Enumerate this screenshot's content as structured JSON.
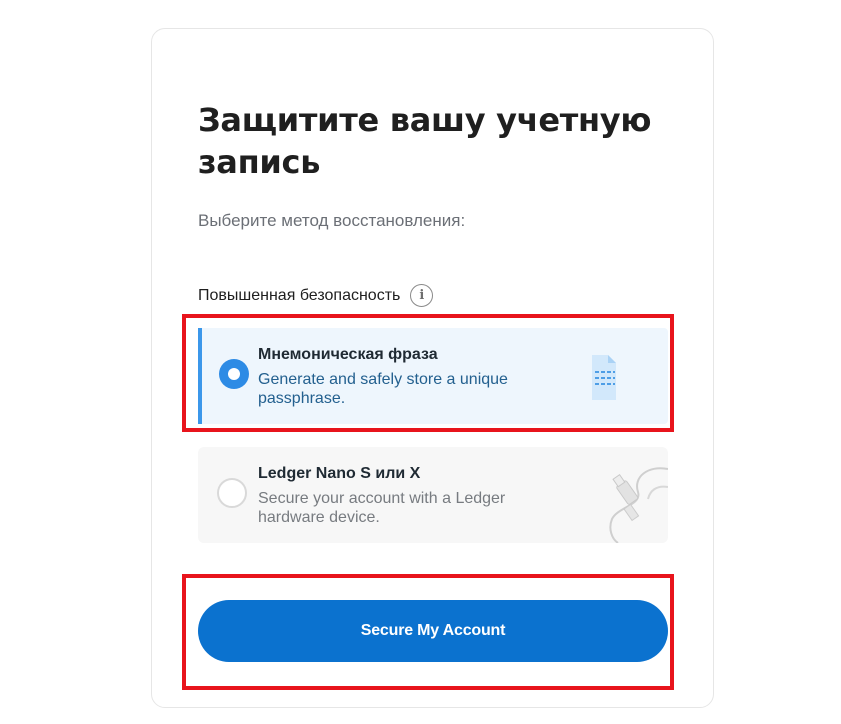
{
  "page": {
    "title": "Защитите вашу учетную запись",
    "subtitle": "Выберите метод восстановления:"
  },
  "section": {
    "label": "Повышенная безопасность",
    "info_icon": "info-icon"
  },
  "options": [
    {
      "title": "Мнемоническая фраза",
      "description": "Generate and safely store a unique passphrase.",
      "selected": true,
      "icon": "document-icon"
    },
    {
      "title": "Ledger Nano S или X",
      "description": "Secure your account with a Ledger hardware device.",
      "selected": false,
      "icon": "usb-device-icon"
    }
  ],
  "cta": {
    "label": "Secure My Account"
  },
  "colors": {
    "accent": "#0b72cf",
    "selected_bg": "#eef6fd",
    "selected_border": "#3b97ea",
    "highlight": "#e8141c"
  }
}
